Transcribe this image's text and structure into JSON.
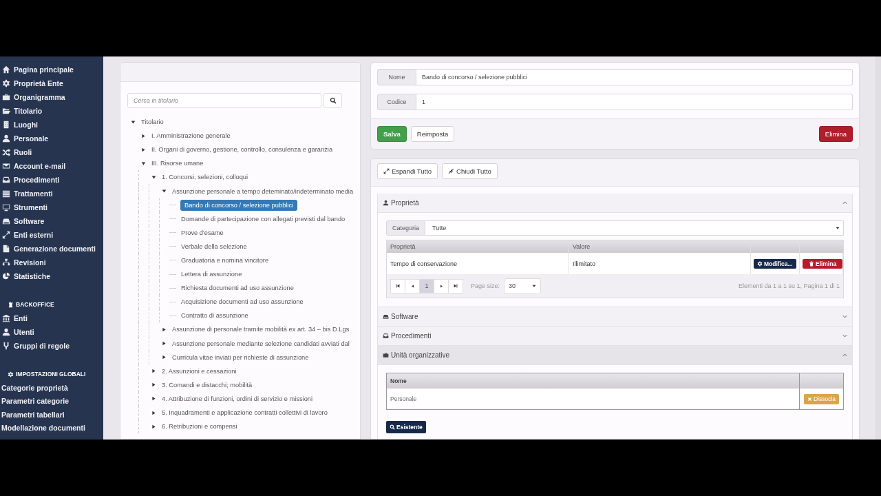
{
  "sidebar": {
    "items": [
      {
        "label": "Pagina principale"
      },
      {
        "label": "Proprietà Ente"
      },
      {
        "label": "Organigramma"
      },
      {
        "label": "Titolario"
      },
      {
        "label": "Luoghi"
      },
      {
        "label": "Personale"
      },
      {
        "label": "Ruoli"
      },
      {
        "label": "Account e-mail"
      },
      {
        "label": "Procedimenti"
      },
      {
        "label": "Trattamenti"
      },
      {
        "label": "Strumenti"
      },
      {
        "label": "Software"
      },
      {
        "label": "Enti esterni"
      },
      {
        "label": "Generazione documenti"
      },
      {
        "label": "Revisioni"
      },
      {
        "label": "Statistiche"
      }
    ],
    "sections": [
      {
        "title": "BACKOFFICE",
        "items": [
          {
            "label": "Enti"
          },
          {
            "label": "Utenti"
          },
          {
            "label": "Gruppi di regole"
          }
        ]
      },
      {
        "title": "IMPOSTAZIONI GLOBALI",
        "items": [
          {
            "label": "Categorie proprietà"
          },
          {
            "label": "Parametri categorie"
          },
          {
            "label": "Parametri tabellari"
          },
          {
            "label": "Modellazione documenti"
          }
        ]
      }
    ]
  },
  "tree": {
    "search": {
      "placeholder": "Cerca in titolario"
    },
    "nodes": [
      {
        "label": "Titolario",
        "kind": "folder",
        "expanded": true,
        "selected": false,
        "children": [
          {
            "label": "I. Amministrazione generale",
            "kind": "folder",
            "expanded": false,
            "selected": false
          },
          {
            "label": "II. Organi di governo, gestione, controllo, consulenza e garanzia",
            "kind": "folder",
            "expanded": false,
            "selected": false
          },
          {
            "label": "III. Risorse umane",
            "kind": "folder",
            "expanded": true,
            "selected": false,
            "children": [
              {
                "label": "1. Concorsi, selezioni, colloqui",
                "kind": "folder",
                "expanded": true,
                "selected": false,
                "children": [
                  {
                    "label": "Assunzione personale a tempo deteminato/indeterminato media",
                    "kind": "folder",
                    "expanded": true,
                    "selected": false,
                    "children": [
                      {
                        "label": "Bando di concorso / selezione pubblici",
                        "kind": "leaf",
                        "selected": true
                      },
                      {
                        "label": "Domande di partecipazione con allegati previsti dal bando",
                        "kind": "leaf",
                        "selected": false
                      },
                      {
                        "label": "Prove d'esame",
                        "kind": "leaf",
                        "selected": false
                      },
                      {
                        "label": "Verbale della selezione",
                        "kind": "leaf",
                        "selected": false
                      },
                      {
                        "label": "Graduatoria e nomina vincitore",
                        "kind": "leaf",
                        "selected": false
                      },
                      {
                        "label": "Lettera di assunzione",
                        "kind": "leaf",
                        "selected": false
                      },
                      {
                        "label": "Richiesta documenti ad uso assunzione",
                        "kind": "leaf",
                        "selected": false
                      },
                      {
                        "label": "Acquisizione documenti ad uso assunzione",
                        "kind": "leaf",
                        "selected": false
                      },
                      {
                        "label": "Contratto di assunzione",
                        "kind": "leaf",
                        "selected": false
                      }
                    ]
                  },
                  {
                    "label": "Assunzione di personale tramite mobilità ex art. 34 – bis D.Lgs",
                    "kind": "folder",
                    "expanded": false,
                    "selected": false
                  },
                  {
                    "label": "Assunzione personale mediante selezione candidati avviati dal",
                    "kind": "folder",
                    "expanded": false,
                    "selected": false
                  },
                  {
                    "label": "Curricula vitae inviati per richieste di assunzione",
                    "kind": "folder",
                    "expanded": false,
                    "selected": false
                  }
                ]
              },
              {
                "label": "2. Assunzioni e cessazioni",
                "kind": "folder",
                "expanded": false,
                "selected": false
              },
              {
                "label": "3. Comandi e distacchi; mobilità",
                "kind": "folder",
                "expanded": false,
                "selected": false
              },
              {
                "label": "4. Attribuzione di funzioni, ordini di servizio e missioni",
                "kind": "folder",
                "expanded": false,
                "selected": false
              },
              {
                "label": "5. Inquadramenti e applicazione contratti collettivi di lavoro",
                "kind": "folder",
                "expanded": false,
                "selected": false
              },
              {
                "label": "6. Retribuzioni e compensi",
                "kind": "folder",
                "expanded": false,
                "selected": false
              }
            ]
          }
        ]
      }
    ]
  },
  "form": {
    "fields": [
      {
        "label": "Nome",
        "value": "Bando di concorso / selezione pubblici"
      },
      {
        "label": "Codice",
        "value": "1"
      }
    ],
    "buttons": [
      {
        "label": "Salva",
        "kind": "success"
      },
      {
        "label": "Reimposta",
        "kind": "default"
      },
      {
        "label": "Elimina",
        "kind": "danger"
      }
    ]
  },
  "toolbar": [
    {
      "label": "Espandi Tutto",
      "kind": "expand"
    },
    {
      "label": "Chiudi Tutto",
      "kind": "collapse"
    }
  ],
  "panels": [
    {
      "title": "Proprietà",
      "kind": "properties",
      "expanded": true,
      "filter": {
        "label": "Categoria",
        "value": "Tutte"
      },
      "columns": [
        "Proprietà",
        "Valore"
      ],
      "rows": [
        {
          "cells": [
            "Tempo di conservazione",
            "Illimitato"
          ],
          "actions": [
            "Modifica...",
            "Elimina"
          ]
        }
      ],
      "pager": {
        "page": "1",
        "page_size_label": "Page size:",
        "page_size": "30",
        "summary": "Elementi da 1 a 1 su 1, Pagina 1 di 1"
      }
    },
    {
      "title": "Software",
      "kind": "software",
      "expanded": false
    },
    {
      "title": "Procedimenti",
      "kind": "procedures",
      "expanded": false
    },
    {
      "title": "Unità organizzative",
      "kind": "units",
      "expanded": true,
      "columns": [
        "Nome"
      ],
      "rows": [
        {
          "cells": [
            "Personale"
          ],
          "actions": [
            "Dissocia"
          ]
        }
      ],
      "button": "Esistente"
    }
  ]
}
